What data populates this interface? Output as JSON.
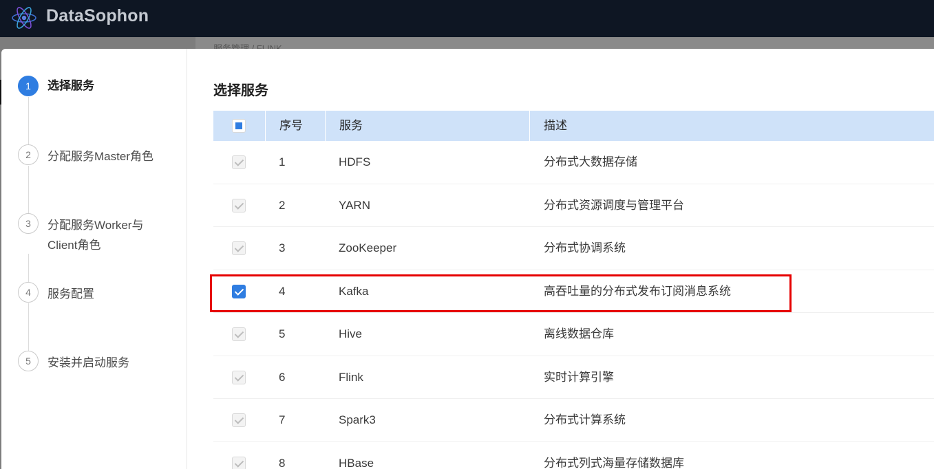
{
  "app": {
    "brand": "DataSophon",
    "logo_icon": "atom-logo-icon"
  },
  "background": {
    "breadcrumb": "服务管理  /  FLINK"
  },
  "steps": [
    {
      "number": "1",
      "label": "选择服务",
      "active": true
    },
    {
      "number": "2",
      "label": "分配服务Master角色",
      "active": false
    },
    {
      "number": "3",
      "label": "分配服务Worker与Client角色",
      "active": false
    },
    {
      "number": "4",
      "label": "服务配置",
      "active": false
    },
    {
      "number": "5",
      "label": "安装并启动服务",
      "active": false
    }
  ],
  "section_title": "选择服务",
  "table": {
    "headers": {
      "no": "序号",
      "service": "服务",
      "description": "描述"
    },
    "select_all_state": "indeterminate",
    "rows": [
      {
        "no": "1",
        "service": "HDFS",
        "description": "分布式大数据存储",
        "state": "disabled-checked"
      },
      {
        "no": "2",
        "service": "YARN",
        "description": "分布式资源调度与管理平台",
        "state": "disabled-checked"
      },
      {
        "no": "3",
        "service": "ZooKeeper",
        "description": "分布式协调系统",
        "state": "disabled-checked"
      },
      {
        "no": "4",
        "service": "Kafka",
        "description": "高吞吐量的分布式发布订阅消息系统",
        "state": "checked"
      },
      {
        "no": "5",
        "service": "Hive",
        "description": "离线数据仓库",
        "state": "disabled-checked"
      },
      {
        "no": "6",
        "service": "Flink",
        "description": "实时计算引擎",
        "state": "disabled-checked"
      },
      {
        "no": "7",
        "service": "Spark3",
        "description": "分布式计算系统",
        "state": "disabled-checked"
      },
      {
        "no": "8",
        "service": "HBase",
        "description": "分布式列式海量存储数据库",
        "state": "disabled-checked"
      }
    ]
  },
  "colors": {
    "primary": "#2f7de1",
    "header_bg": "#0e1623",
    "table_head": "#cfe2f9",
    "highlight": "#e60000"
  }
}
